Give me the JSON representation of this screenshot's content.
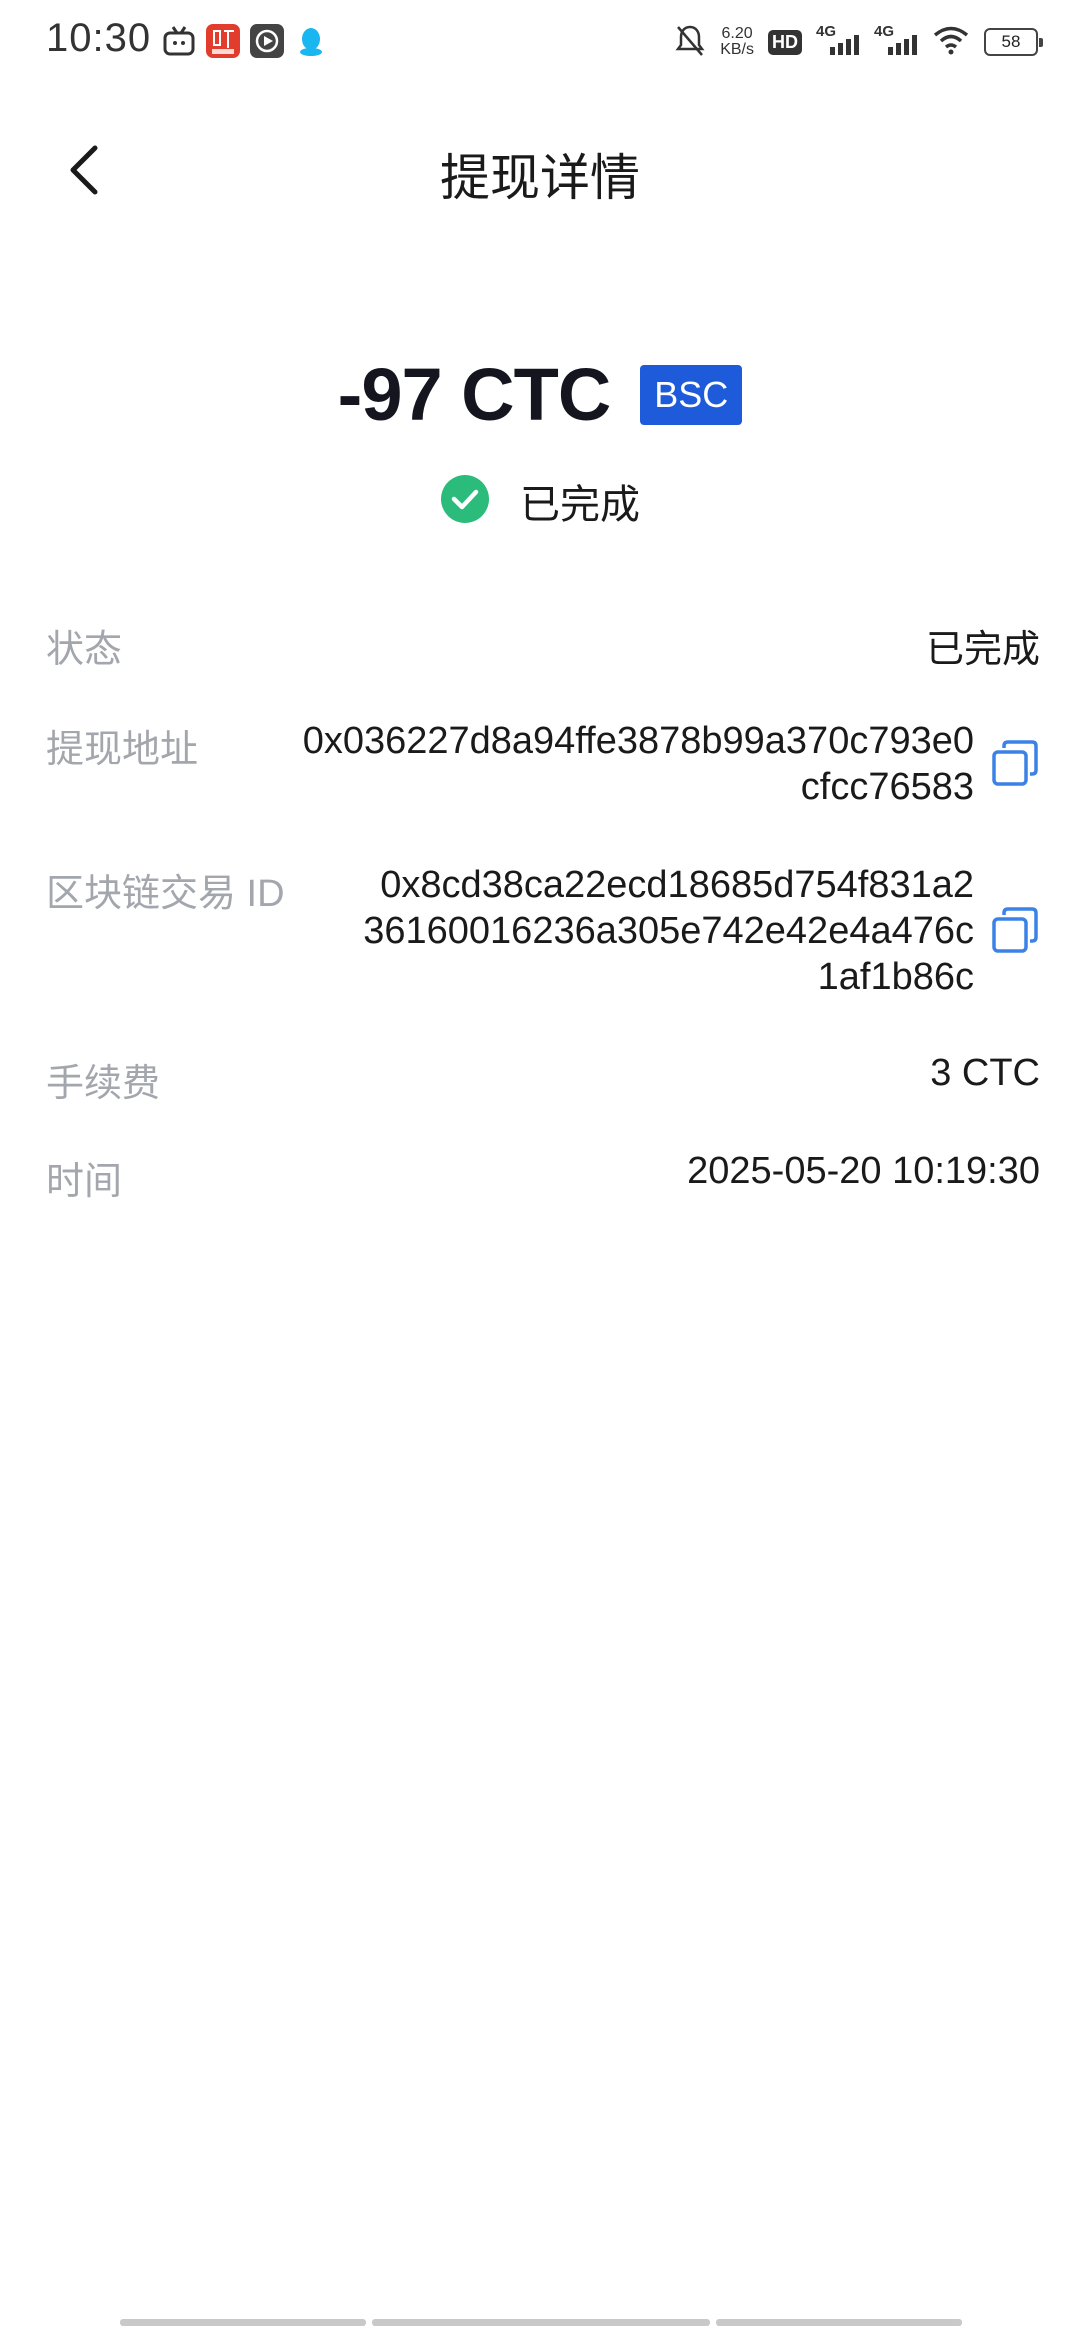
{
  "status_bar": {
    "time": "10:30",
    "speed_value": "6.20",
    "speed_unit": "KB/s",
    "hd_label": "HD",
    "net1_label": "4G",
    "net2_label": "4G",
    "battery": "58"
  },
  "header": {
    "title": "提现详情"
  },
  "summary": {
    "amount": "-97 CTC",
    "chain": "BSC",
    "status": "已完成"
  },
  "details": {
    "status_label": "状态",
    "status_value": "已完成",
    "address_label": "提现地址",
    "address_line1": "0x036227d8a94ffe3878b99a370c793e0",
    "address_line2": "cfcc76583",
    "txid_label": "区块链交易 ID",
    "txid_line1": "0x8cd38ca22ecd18685d754f831a2",
    "txid_line2": "36160016236a305e742e42e4a476c",
    "txid_line3": "1af1b86c",
    "fee_label": "手续费",
    "fee_value": "3 CTC",
    "time_label": "时间",
    "time_value": "2025-05-20 10:19:30"
  },
  "colors": {
    "accent_blue": "#1d5bdb",
    "success_green": "#2bbb7a",
    "copy_icon": "#3b82e6",
    "label_gray": "#a3a7ad"
  }
}
